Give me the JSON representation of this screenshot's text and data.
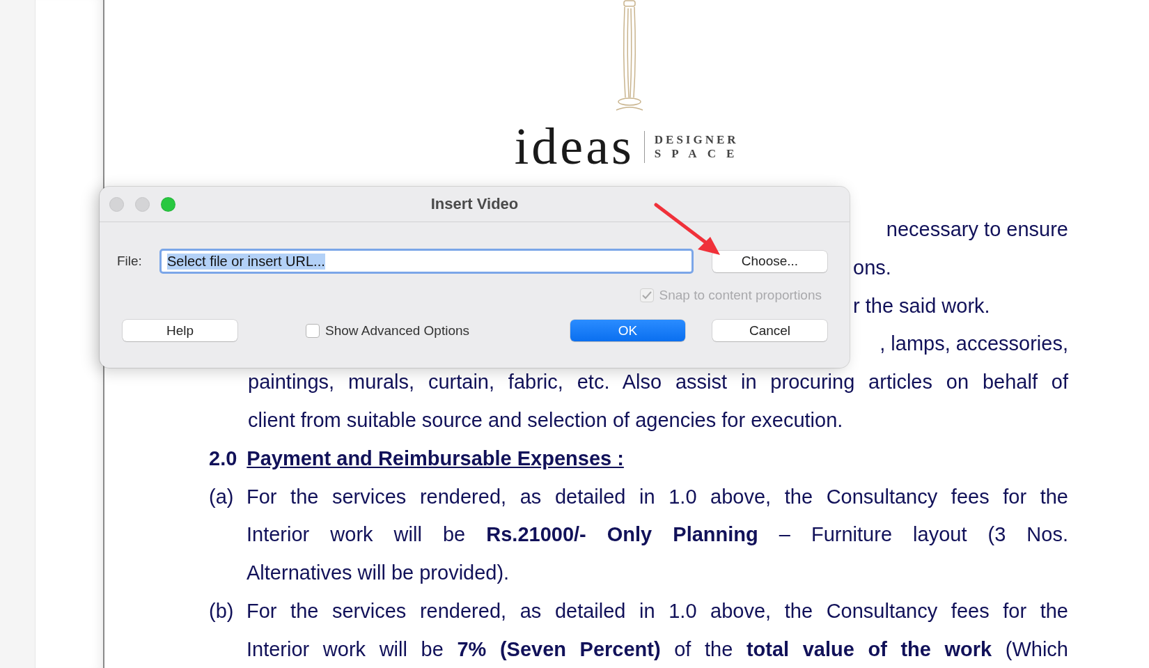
{
  "document": {
    "logo": {
      "name": "ideas",
      "tagline": [
        "DESIGNER",
        "SPACE"
      ]
    },
    "lines": [
      {
        "kind": "end",
        "text": "necessary to ensure"
      },
      {
        "kind": "start",
        "text": "ons."
      },
      {
        "kind": "start",
        "text": "r the said work."
      },
      {
        "kind": "end",
        "text": ", lamps, accessories,"
      },
      {
        "kind": "justified",
        "text": "paintings, murals, curtain, fabric, etc. Also assist in procuring articles on behalf of"
      },
      {
        "kind": "last",
        "text": "client from suitable source and selection of agencies for execution."
      }
    ],
    "section": {
      "number": "2.0",
      "title": "Payment and Reimbursable Expenses :"
    },
    "items": [
      {
        "label": "(a)",
        "lines": [
          {
            "kind": "justified",
            "text": "For the services rendered, as detailed in 1.0 above, the Consultancy fees for the"
          },
          {
            "kind": "justified",
            "text": "Interior work will be **Rs.21000/- Only Planning** – Furniture layout (3 Nos."
          },
          {
            "kind": "last",
            "text": "Alternatives will be provided)."
          }
        ]
      },
      {
        "label": "(b)",
        "lines": [
          {
            "kind": "justified",
            "text": "For the services rendered, as detailed in 1.0 above, the Consultancy fees for the"
          },
          {
            "kind": "justified",
            "text": "Interior work will be **7% (Seven Percent)** of the **total value of the work** (Which"
          }
        ]
      }
    ]
  },
  "dialog": {
    "title": "Insert Video",
    "window_buttons": [
      {
        "kind": "close",
        "disabled": true
      },
      {
        "kind": "minimize",
        "disabled": true
      },
      {
        "kind": "zoom",
        "disabled": false
      }
    ],
    "file_label": "File:",
    "file_value": "Select file or insert URL...",
    "choose_button": "Choose...",
    "snap": {
      "label": "Snap to content proportions",
      "checked": true,
      "disabled": true
    },
    "help_button": "Help",
    "advanced": {
      "label": "Show Advanced Options",
      "checked": false
    },
    "ok_button": "OK",
    "cancel_button": "Cancel"
  }
}
